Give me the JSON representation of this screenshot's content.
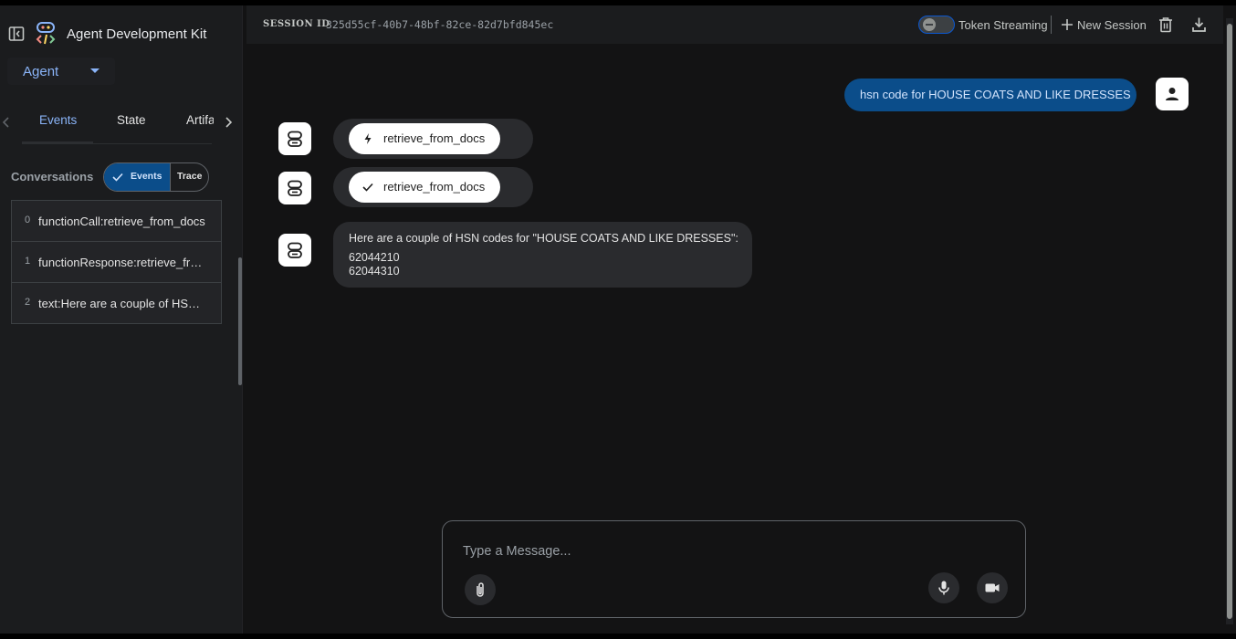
{
  "sidebar": {
    "app_title": "Agent Development Kit",
    "agent_select_value": "Agent",
    "tabs": [
      {
        "label": "Events",
        "active": true
      },
      {
        "label": "State",
        "active": false
      },
      {
        "label": "Artifacts",
        "active": false
      }
    ],
    "conversations_label": "Conversations",
    "view_toggle": {
      "events_label": "Events",
      "trace_label": "Trace",
      "selected": "Events"
    },
    "events": [
      {
        "index": "0",
        "text": "functionCall:retrieve_from_docs"
      },
      {
        "index": "1",
        "text": "functionResponse:retrieve_from_docs"
      },
      {
        "index": "2",
        "text": "text:Here are a couple of HSN codes"
      }
    ]
  },
  "topbar": {
    "session_label": "SESSION ID",
    "session_id": "325d55cf-40b7-48bf-82ce-82d7bfd845ec",
    "token_streaming_label": "Token Streaming",
    "token_streaming_enabled": false,
    "new_session_label": "New Session"
  },
  "chat": {
    "user_message": "hsn code for HOUSE COATS AND LIKE DRESSES",
    "tool_call": {
      "icon": "bolt-icon",
      "label": "retrieve_from_docs"
    },
    "tool_response": {
      "icon": "check-icon",
      "label": "retrieve_from_docs"
    },
    "bot_reply": {
      "intro": "Here are a couple of HSN codes for \"HOUSE COATS AND LIKE DRESSES\":",
      "codes": [
        "62044210",
        "62044310"
      ]
    }
  },
  "composer": {
    "placeholder": "Type a Message..."
  },
  "colors": {
    "accent": "#8ab4f8",
    "user_bubble": "#0b4d8a",
    "background": "#131314",
    "sidebar": "#1b1c1e"
  }
}
